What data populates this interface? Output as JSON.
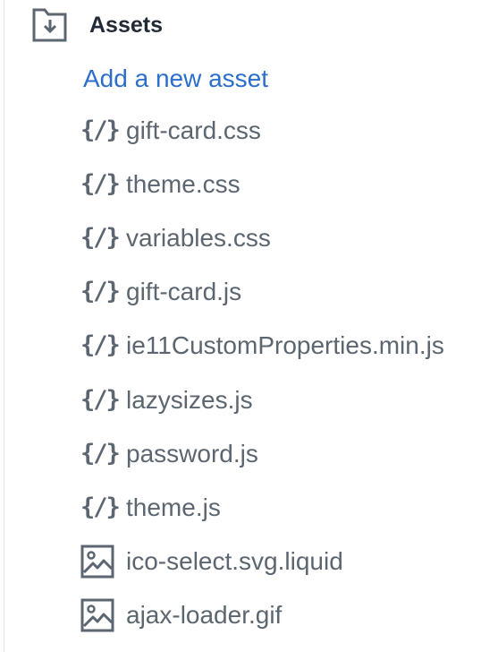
{
  "section": {
    "title": "Assets",
    "header_icon": "folder-download-icon",
    "add_link_label": "Add a new asset"
  },
  "files": [
    {
      "name": "gift-card.css",
      "icon": "code-icon"
    },
    {
      "name": "theme.css",
      "icon": "code-icon"
    },
    {
      "name": "variables.css",
      "icon": "code-icon"
    },
    {
      "name": "gift-card.js",
      "icon": "code-icon"
    },
    {
      "name": "ie11CustomProperties.min.js",
      "icon": "code-icon"
    },
    {
      "name": "lazysizes.js",
      "icon": "code-icon"
    },
    {
      "name": "password.js",
      "icon": "code-icon"
    },
    {
      "name": "theme.js",
      "icon": "code-icon"
    },
    {
      "name": "ico-select.svg.liquid",
      "icon": "image-icon"
    },
    {
      "name": "ajax-loader.gif",
      "icon": "image-icon"
    }
  ],
  "code_glyph": "{/}",
  "colors": {
    "title": "#212b36",
    "link": "#2c6ecb",
    "file_text": "#5c6670",
    "icon": "#5c6670"
  }
}
